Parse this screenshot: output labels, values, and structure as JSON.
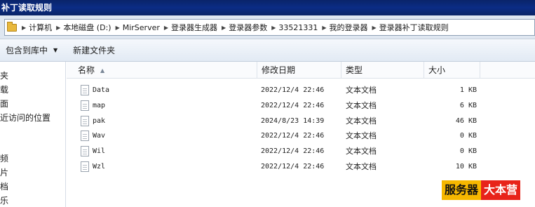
{
  "window": {
    "title": "补丁读取规则"
  },
  "address_bar": {
    "crumbs": [
      "计算机",
      "本地磁盘 (D:)",
      "MirServer",
      "登录器生成器",
      "登录器参数",
      "33521331",
      "我的登录器",
      "登录器补丁读取规则"
    ]
  },
  "toolbar": {
    "include_library_label": "包含到库中",
    "new_folder_label": "新建文件夹"
  },
  "nav_pane": {
    "items": [
      "夹",
      "载",
      "面",
      "近访问的位置",
      "",
      "频",
      "片",
      "档",
      "乐"
    ]
  },
  "file_list": {
    "columns": {
      "name": "名称",
      "date": "修改日期",
      "type": "类型",
      "size": "大小"
    },
    "rows": [
      {
        "name": "Data",
        "date": "2022/12/4 22:46",
        "type": "文本文档",
        "size": "1 KB"
      },
      {
        "name": "map",
        "date": "2022/12/4 22:46",
        "type": "文本文档",
        "size": "6 KB"
      },
      {
        "name": "pak",
        "date": "2024/8/23 14:39",
        "type": "文本文档",
        "size": "46 KB"
      },
      {
        "name": "Wav",
        "date": "2022/12/4 22:46",
        "type": "文本文档",
        "size": "0 KB"
      },
      {
        "name": "Wil",
        "date": "2022/12/4 22:46",
        "type": "文本文档",
        "size": "0 KB"
      },
      {
        "name": "Wzl",
        "date": "2022/12/4 22:46",
        "type": "文本文档",
        "size": "10 KB"
      }
    ]
  },
  "watermark": {
    "part1": "服务器",
    "part2": "大本营"
  }
}
